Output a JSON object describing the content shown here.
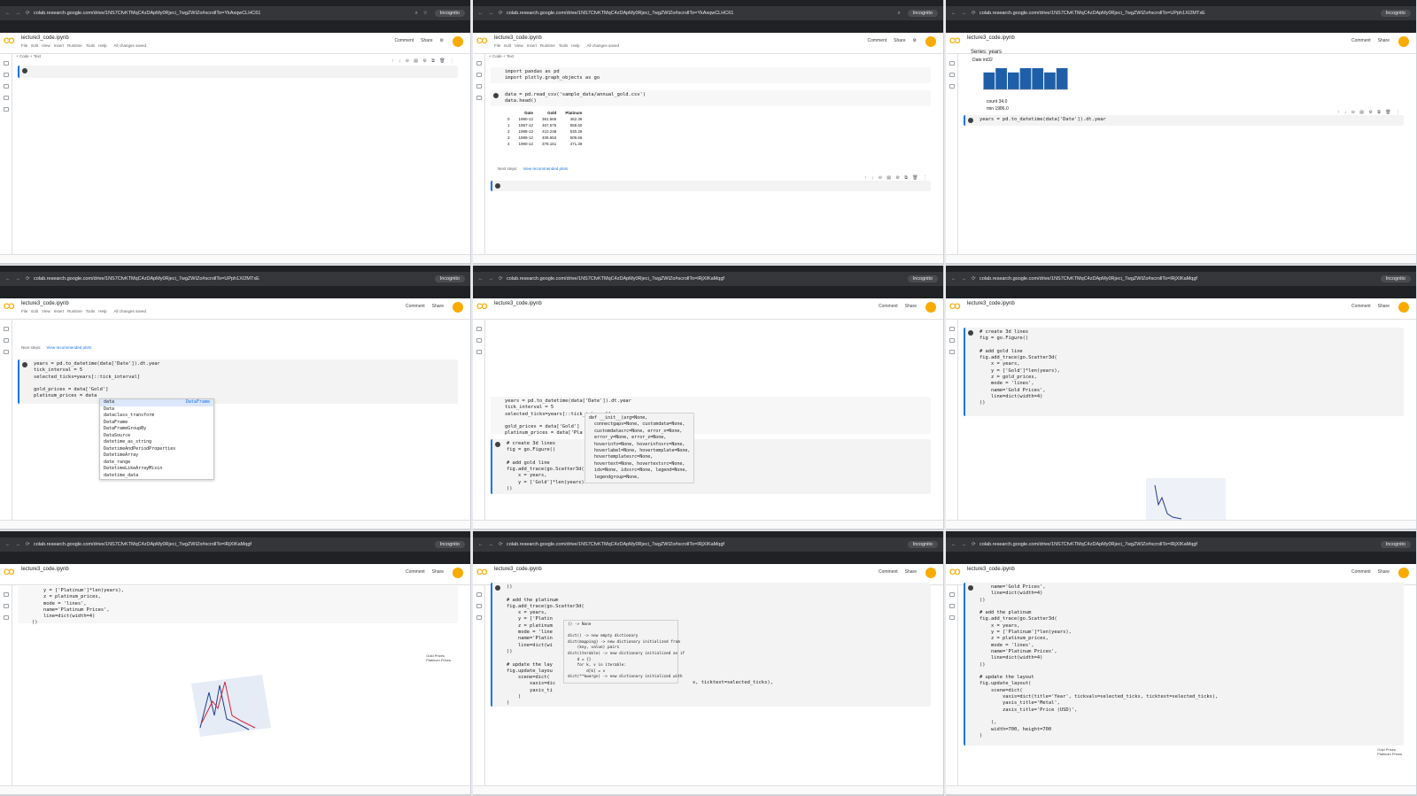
{
  "browser": {
    "url_a": "colab.research.google.com/drive/1NS7CfvKTMqC4zDApMy0Rjeci_7wgZWIZo#scrollTo=YkAxqwCLHC61",
    "url_b": "colab.research.google.com/drive/1NS7CfvKTMqC4zDApMy0Rjeci_7wgZWIZo#scrollTo=UPph1XI2MTxE",
    "url_c": "colab.research.google.com/drive/1NS7CfvKTMqC4zDApMy0Rjeci_7wgZWIZo#scrollTo=lRjXIKaMqgf",
    "incognito": "Incognito"
  },
  "colab": {
    "file_name": "lecture3_code.ipynb",
    "menus": [
      "File",
      "Edit",
      "View",
      "Insert",
      "Runtime",
      "Tools",
      "Help"
    ],
    "saved": "All changes saved",
    "comment": "Comment",
    "share": "Share",
    "code_btn": "+ Code",
    "text_btn": "+ Text",
    "logo": "CO"
  },
  "panel1": {
    "code": ""
  },
  "panel2": {
    "code1": "import pandas as pd\nimport plotly.graph_objects as go",
    "code2": "data = pd.read_csv('sample_data/annual_gold.csv')\ndata.head()",
    "table_headers": [
      "",
      "Date",
      "Gold",
      "Platinum"
    ],
    "table_rows": [
      [
        "0",
        "1990-12",
        "381.565",
        "462.39"
      ],
      [
        "1",
        "1987-12",
        "467.575",
        "558.60"
      ],
      [
        "2",
        "1988-12",
        "410.248",
        "530.28"
      ],
      [
        "3",
        "1989-12",
        "408.653",
        "509.66"
      ],
      [
        "4",
        "1990-12",
        "378.161",
        "471.39"
      ]
    ],
    "next_steps": "Next steps:",
    "view_plots": "View recommended plots"
  },
  "panel3": {
    "series_title": "Series: years",
    "dtype": "Date int32",
    "stat_count_label": "count",
    "stat_count": "34.0",
    "stat_min_label": "min",
    "stat_min": "1986.0",
    "code": "years = pd.to_datetime(data['Date']).dt.year",
    "hist_values": [
      4,
      5,
      4,
      5,
      5,
      4,
      5
    ]
  },
  "panel4": {
    "code": "years = pd.to_datetime(data['Date']).dt.year\ntick_interval = 5\nselected_ticks=years[::tick_interval]\n\ngold_prices = data['Gold']\nplatinum_prices = data",
    "suggestions": [
      "data",
      "Data",
      "dataclass_transform",
      "DataFrame",
      "DataFrameGroupBy",
      "DataSource",
      "datetime_as_string",
      "DatetimeAndPeriodProperties",
      "DatetimeArray",
      "date_range",
      "DatetimeLikeArrayMixin",
      "datetime_data"
    ],
    "suggest_type": "DataFrame"
  },
  "panel5": {
    "code1": "years = pd.to_datetime(data['Date']).dt.year\ntick_interval = 5\nselected_ticks=years[::tick_interval]\n\ngold_prices = data['Gold']\nplatinum_prices = data['Pla",
    "code2": "# create 3d lines\nfig = go.Figure()\n\n# add gold line\nfig.add_trace(go.Scatter3d(\n    x = years,\n    y = ['Gold']*len(years)\n))",
    "signature": "def __init__(arg=None,\n  connectgaps=None, customdata=None,\n  customdatasrc=None, error_x=None,\n  error_y=None, error_z=None,\n  hoverinfo=None, hoverinfosrc=None,\n  hoverlabel=None, hovertemplate=None,\n  hovertemplatesrc=None,\n  hovertext=None, hovertextsrc=None,\n  ids=None, idssrc=None, legend=None,\n  legendgroup=None,"
  },
  "panel6": {
    "code": "# create 3d lines\nfig = go.Figure()\n\n# add gold line\nfig.add_trace(go.Scatter3d(\n    x = years,\n    y = ['Gold']*len(years),\n    z = gold_prices,\n    mode = 'lines',\n    name='Gold Prices',\n    line=dict(width=4)\n))"
  },
  "panel7": {
    "code": "    y = ['Platinum']*len(years),\n    z = platinum_prices,\n    mode = 'lines',\n    name='Platinum Prices',\n    line=dict(width=4)\n))",
    "legend": [
      "Gold Prices",
      "Platinum Prices"
    ]
  },
  "panel8": {
    "code": "))\n\n# add the platinum\nfig.add_trace(go.Scatter3d(\n    x = years,\n    y = ['Platin\n    z = platinum\n    mode = 'line\n    name='Platin\n    line=dict(wi\n))\n\n# update the lay\nfig.update_layou\n    scene=dict(\n        xaxis=dic\n        yaxis_ti\n    )\n)",
    "tail": "s, ticktext=selected_ticks),",
    "doc": "() -> None\n\ndict() -> new empty dictionary\ndict(mapping) -> new dictionary initialized from\n    (key, value) pairs\ndict(iterable) -> new dictionary initialized as if\n    d = {}\n    for k, v in iterable:\n        d[k] = v\ndict(**kwargs) -> new dictionary initialized with"
  },
  "panel9": {
    "code": "    name='Gold Prices',\n    line=dict(width=4)\n))\n\n# add the platinum\nfig.add_trace(go.Scatter3d(\n    x = years,\n    y = ['Platinum']*len(years),\n    z = platinum_prices,\n    mode = 'lines',\n    name='Platinum Prices',\n    line=dict(width=4)\n))\n\n# update the layout\nfig.update_layout(\n    scene=dict(\n        xaxis=dict(title='Year', tickvals=selected_ticks, ticktext=selected_ticks),\n        yaxis_title='Metal',\n        zaxis_title='Price (USD)',\n\n    ),\n    width=700, height=700\n)",
    "legend": [
      "Gold Prices",
      "Platinum Prices"
    ]
  }
}
